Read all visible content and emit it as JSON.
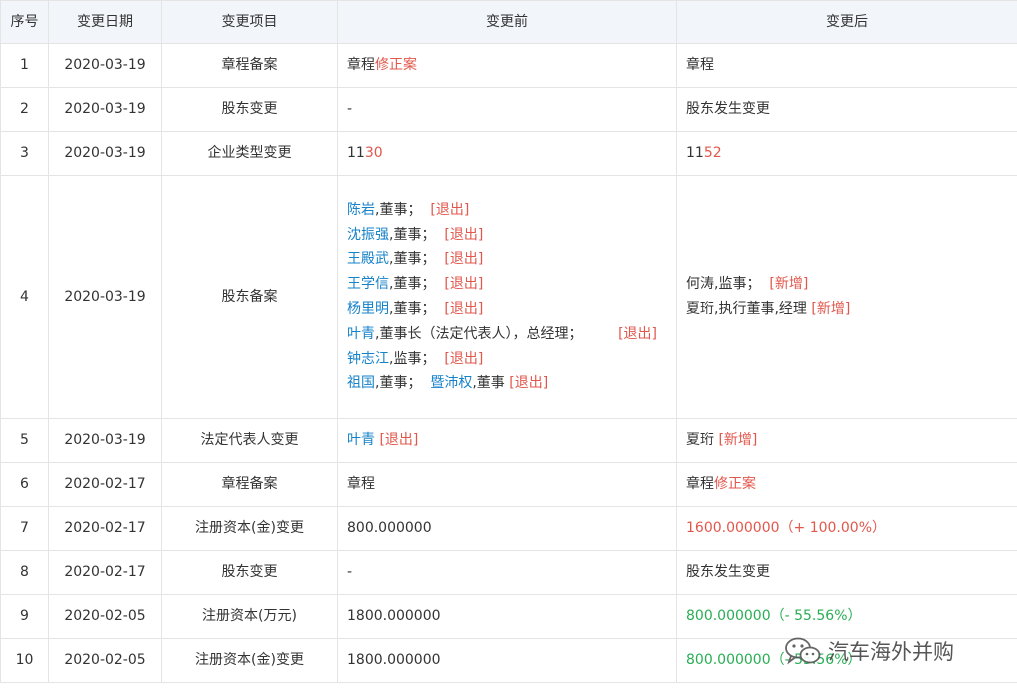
{
  "headers": [
    "序号",
    "变更日期",
    "变更项目",
    "变更前",
    "变更后"
  ],
  "rows": [
    {
      "no": "1",
      "date": "2020-03-19",
      "item": "章程备案",
      "before": [
        [
          {
            "t": "章程"
          },
          {
            "t": "修正案",
            "c": "red"
          }
        ]
      ],
      "after": [
        [
          {
            "t": "章程"
          }
        ]
      ]
    },
    {
      "no": "2",
      "date": "2020-03-19",
      "item": "股东变更",
      "before": [
        [
          {
            "t": "-"
          }
        ]
      ],
      "after": [
        [
          {
            "t": "股东发生变更"
          }
        ]
      ]
    },
    {
      "no": "3",
      "date": "2020-03-19",
      "item": "企业类型变更",
      "before": [
        [
          {
            "t": "11"
          },
          {
            "t": "30",
            "c": "red"
          }
        ]
      ],
      "after": [
        [
          {
            "t": "11"
          },
          {
            "t": "52",
            "c": "red"
          }
        ]
      ]
    },
    {
      "no": "4",
      "date": "2020-03-19",
      "item": "股东备案",
      "before": [
        [
          {
            "t": "陈岩",
            "c": "blue"
          },
          {
            "t": ",董事；  "
          },
          {
            "t": "[退出]",
            "c": "red"
          }
        ],
        [
          {
            "t": "沈振强",
            "c": "blue"
          },
          {
            "t": ",董事；  "
          },
          {
            "t": "[退出]",
            "c": "red"
          }
        ],
        [
          {
            "t": "王殿武",
            "c": "blue"
          },
          {
            "t": ",董事；  "
          },
          {
            "t": "[退出]",
            "c": "red"
          }
        ],
        [
          {
            "t": "王学信",
            "c": "blue"
          },
          {
            "t": ",董事；  "
          },
          {
            "t": "[退出]",
            "c": "red"
          }
        ],
        [
          {
            "t": "杨里明",
            "c": "blue"
          },
          {
            "t": ",董事；  "
          },
          {
            "t": "[退出]",
            "c": "red"
          }
        ],
        [
          {
            "t": "叶青",
            "c": "blue"
          },
          {
            "t": ",董事长（法定代表人），总经理；        "
          },
          {
            "t": "[退出]",
            "c": "red"
          }
        ],
        [
          {
            "t": "钟志江",
            "c": "blue"
          },
          {
            "t": ",监事；  "
          },
          {
            "t": "[退出]",
            "c": "red"
          }
        ],
        [
          {
            "t": "祖国",
            "c": "blue"
          },
          {
            "t": ",董事；  "
          },
          {
            "t": "暨沛权",
            "c": "blue"
          },
          {
            "t": ",董事 "
          },
          {
            "t": "[退出]",
            "c": "red"
          }
        ]
      ],
      "after": [
        [
          {
            "t": "何涛"
          },
          {
            "t": ",监事；  "
          },
          {
            "t": "[新增]",
            "c": "red"
          }
        ],
        [
          {
            "t": "夏珩"
          },
          {
            "t": ",执行董事,经理 "
          },
          {
            "t": "[新增]",
            "c": "red"
          }
        ]
      ]
    },
    {
      "no": "5",
      "date": "2020-03-19",
      "item": "法定代表人变更",
      "before": [
        [
          {
            "t": "叶青",
            "c": "blue"
          },
          {
            "t": " "
          },
          {
            "t": "[退出]",
            "c": "red"
          }
        ]
      ],
      "after": [
        [
          {
            "t": "夏珩 "
          },
          {
            "t": "[新增]",
            "c": "red"
          }
        ]
      ]
    },
    {
      "no": "6",
      "date": "2020-02-17",
      "item": "章程备案",
      "before": [
        [
          {
            "t": "章程"
          }
        ]
      ],
      "after": [
        [
          {
            "t": "章程"
          },
          {
            "t": "修正案",
            "c": "red"
          }
        ]
      ]
    },
    {
      "no": "7",
      "date": "2020-02-17",
      "item": "注册资本(金)变更",
      "before": [
        [
          {
            "t": "800.000000"
          }
        ]
      ],
      "after": [
        [
          {
            "t": "1600.000000（+ 100.00%）",
            "c": "red"
          }
        ]
      ]
    },
    {
      "no": "8",
      "date": "2020-02-17",
      "item": "股东变更",
      "before": [
        [
          {
            "t": "-"
          }
        ]
      ],
      "after": [
        [
          {
            "t": "股东发生变更"
          }
        ]
      ]
    },
    {
      "no": "9",
      "date": "2020-02-05",
      "item": "注册资本(万元)",
      "before": [
        [
          {
            "t": "1800.000000"
          }
        ]
      ],
      "after": [
        [
          {
            "t": "800.000000（- 55.56%）",
            "c": "green"
          }
        ]
      ]
    },
    {
      "no": "10",
      "date": "2020-02-05",
      "item": "注册资本(金)变更",
      "before": [
        [
          {
            "t": "1800.000000"
          }
        ]
      ],
      "after": [
        [
          {
            "t": "800.000000（- 55.56%）",
            "c": "green"
          }
        ]
      ]
    }
  ],
  "watermark": {
    "text": "汽车海外并购",
    "icon": "wechat-icon"
  },
  "colors": {
    "header_bg": "#f2f6fb",
    "border": "#e4e4e4",
    "red": "#e2574c",
    "blue": "#1682c9",
    "green": "#2aad55",
    "text": "#333333"
  }
}
